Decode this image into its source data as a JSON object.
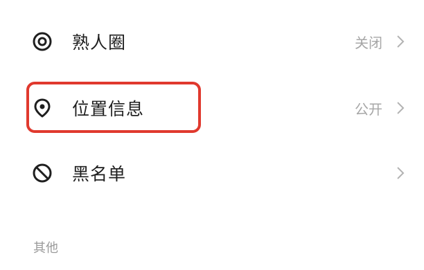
{
  "settings": {
    "rows": [
      {
        "label": "熟人圈",
        "value": "关闭",
        "icon": "target-icon"
      },
      {
        "label": "位置信息",
        "value": "公开",
        "icon": "location-pin-icon"
      },
      {
        "label": "黑名单",
        "value": "",
        "icon": "block-icon"
      }
    ]
  },
  "section": {
    "title": "其他"
  },
  "colors": {
    "highlight": "#e0392e",
    "label": "#1f1f1f",
    "secondary": "#a6a6a6"
  }
}
